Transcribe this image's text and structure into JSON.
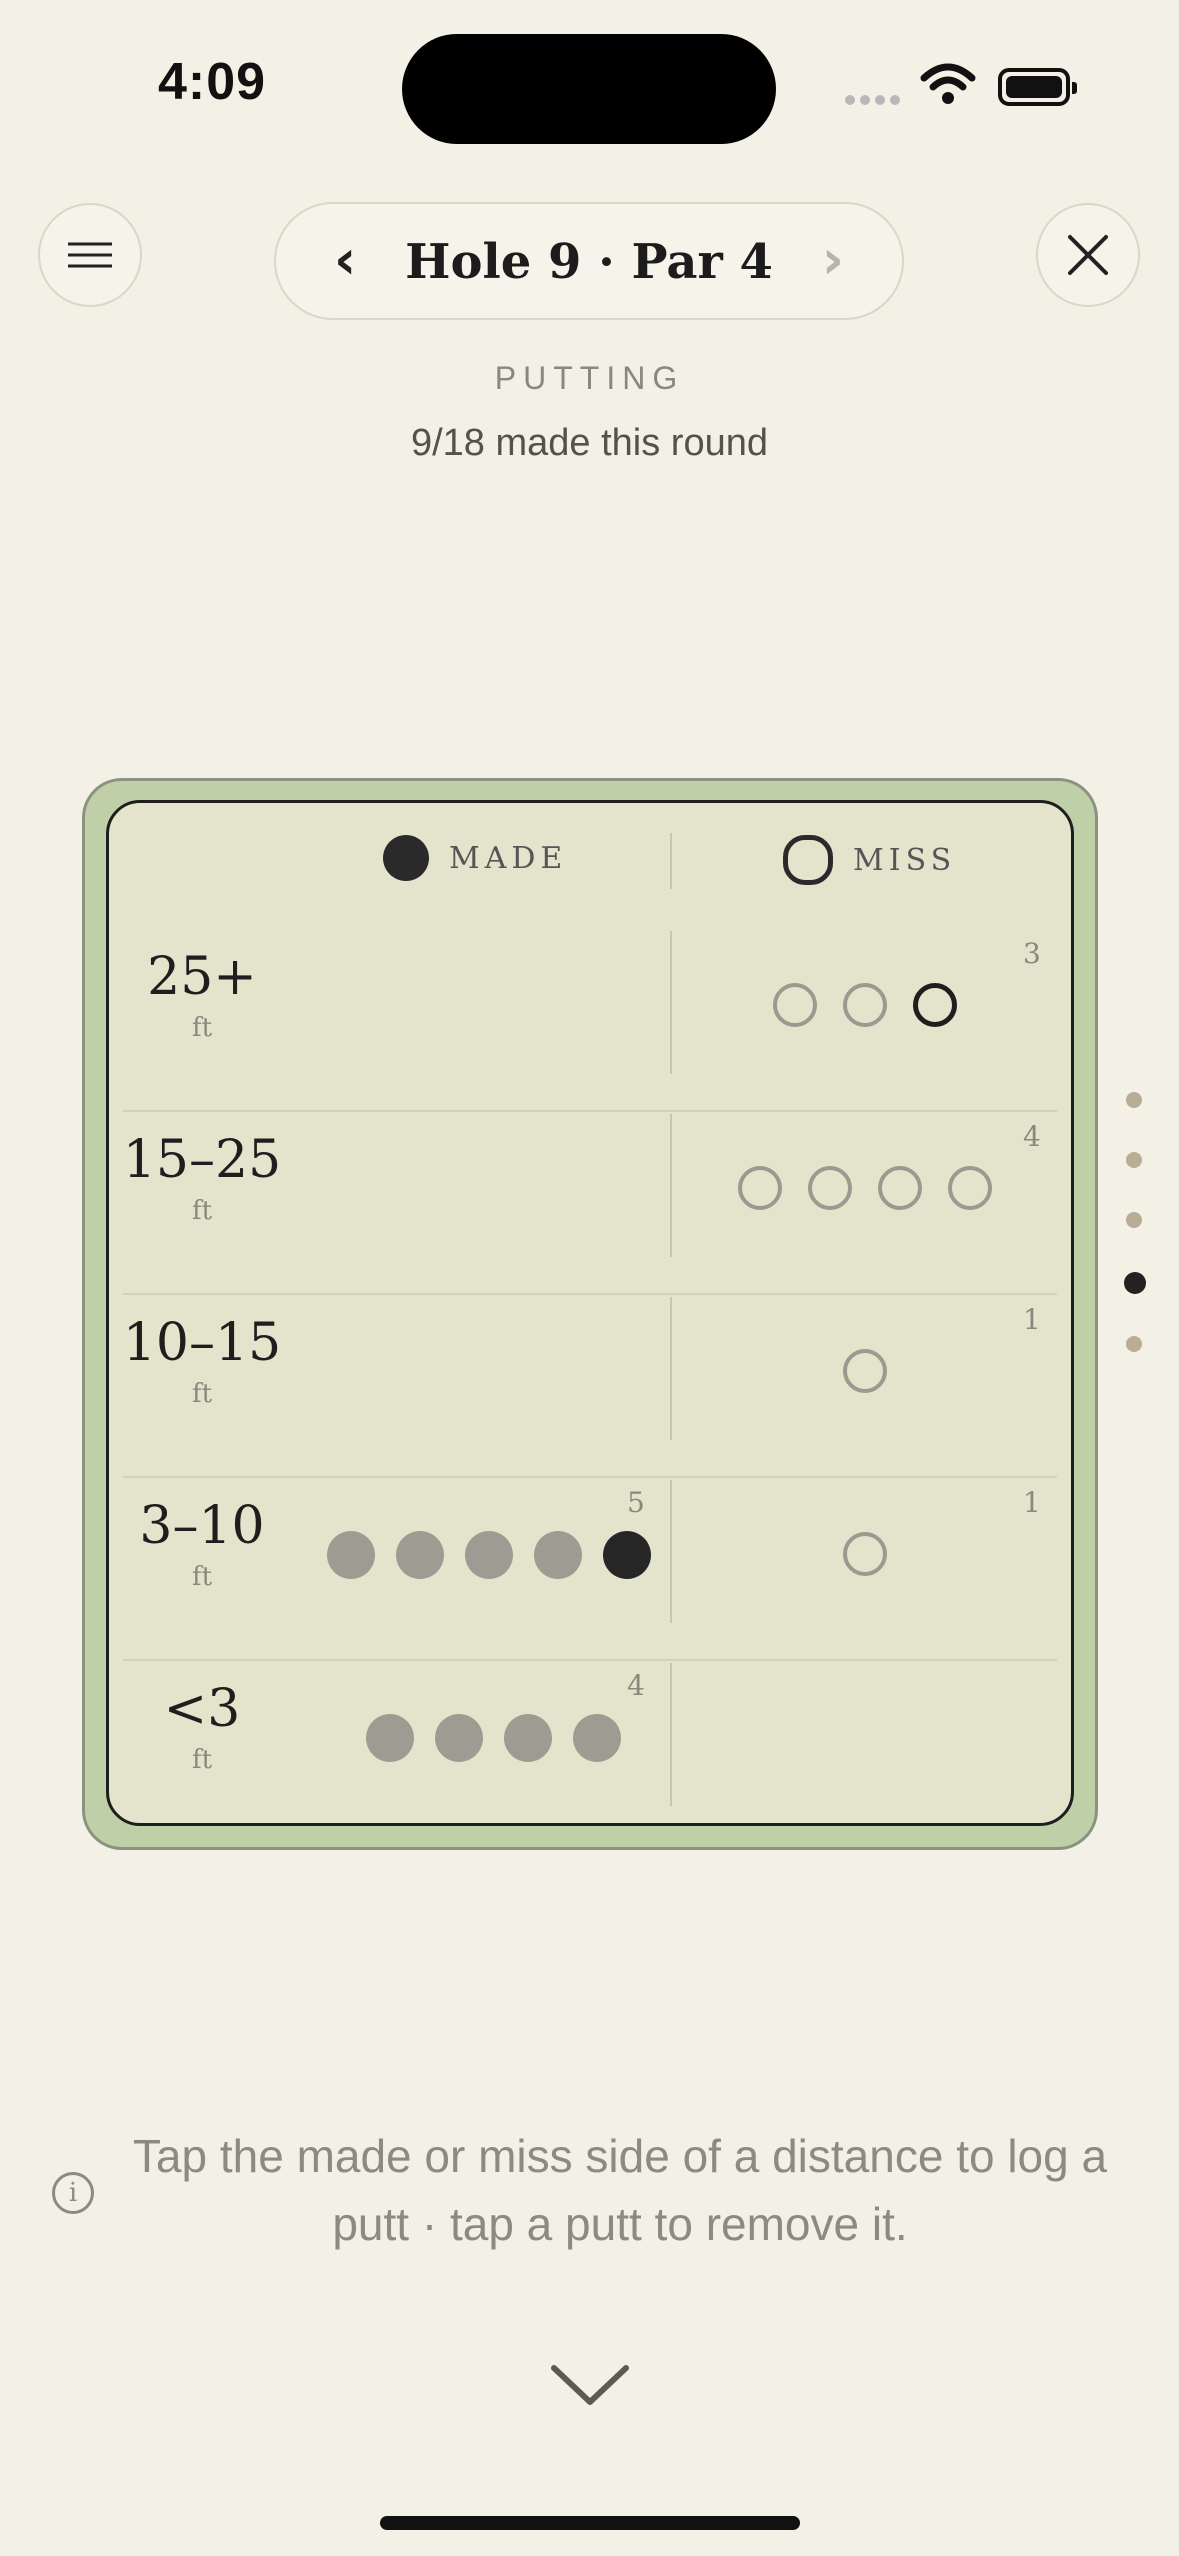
{
  "status_bar": {
    "time": "4:09"
  },
  "header": {
    "hole_title": "Hole 9 · Par 4",
    "prev_label": "‹",
    "next_label": "›"
  },
  "section": {
    "label": "PUTTING",
    "summary": "9/18 made this round"
  },
  "table": {
    "made_header": "MADE",
    "miss_header": "MISS",
    "rows": [
      {
        "distance": "25+",
        "unit": "ft",
        "made": 0,
        "made_count": "",
        "miss": 3,
        "miss_count": "3"
      },
      {
        "distance": "15–25",
        "unit": "ft",
        "made": 0,
        "made_count": "",
        "miss": 4,
        "miss_count": "4"
      },
      {
        "distance": "10–15",
        "unit": "ft",
        "made": 0,
        "made_count": "",
        "miss": 1,
        "miss_count": "1"
      },
      {
        "distance": "3–10",
        "unit": "ft",
        "made": 5,
        "made_count": "5",
        "miss": 1,
        "miss_count": "1"
      },
      {
        "distance": "<3",
        "unit": "ft",
        "made": 4,
        "made_count": "4",
        "miss": 0,
        "miss_count": ""
      }
    ]
  },
  "pager": {
    "count": 5,
    "active_index": 3
  },
  "hint": {
    "text": "Tap the made or miss side of a distance to log a putt · tap a putt to remove it."
  },
  "colors": {
    "background": "#f3f0e6",
    "card_border": "#bfd0a8",
    "card_fill": "#e4e3cc"
  }
}
